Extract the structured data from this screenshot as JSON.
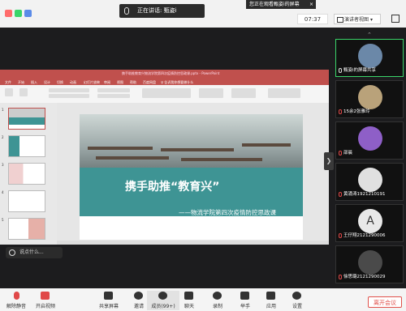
{
  "topbar": {
    "speaking_label": "正在讲话: 甄姿i",
    "viewing_label": "您正在观看甄姿i的屏幕",
    "close_icon": "×",
    "time": "07:37",
    "view_button": "演讲者视图",
    "view_caret": "▾"
  },
  "presentation": {
    "window_title": "携手助推教育兴物流学院第四次疫情防控思政课.pptx - PowerPoint",
    "tabs": [
      "文件",
      "开始",
      "插入",
      "设计",
      "切换",
      "动画",
      "幻灯片放映",
      "审阅",
      "视图",
      "帮助",
      "百度网盘",
      "♀ 告诉我你想要做什么"
    ],
    "slide_title": "携手助推“教育兴”",
    "slide_subtitle": "——物流学院第四次疫情防控思政课",
    "thumb_numbers": [
      "1",
      "2",
      "3",
      "4",
      "5"
    ]
  },
  "chat_bubble": "说点什么...",
  "collapse_arrow": "❯",
  "panel_up_arrow": "⌃",
  "participants": [
    {
      "name": "甄姿i的屏幕共享",
      "mic_muted": false,
      "avatar_color": "#6b88a8",
      "active": true
    },
    {
      "name": "15余2张雅玲",
      "mic_muted": true,
      "avatar_color": "#b9a27a",
      "active": false
    },
    {
      "name": "邵晨",
      "mic_muted": true,
      "avatar_color": "#8e5fc7",
      "active": false
    },
    {
      "name": "黄涌涛1921210191",
      "mic_muted": true,
      "avatar_color": "#e0e0e0",
      "active": false
    },
    {
      "name": "王仔翔2121290006",
      "mic_muted": true,
      "avatar_color": "#e8e8e8",
      "active": false,
      "letter": "A"
    },
    {
      "name": "徐思璐2121290029",
      "mic_muted": true,
      "avatar_color": "#4a4a4a",
      "active": false
    }
  ],
  "toolbar": {
    "items": [
      {
        "label": "解除静音",
        "icon": "mic-icon"
      },
      {
        "label": "开启视频",
        "icon": "video-icon"
      },
      {
        "label": "共享屏幕",
        "icon": "share-screen-icon"
      },
      {
        "label": "邀请",
        "icon": "invite-icon"
      },
      {
        "label": "成员(99+)",
        "icon": "members-icon"
      },
      {
        "label": "聊天",
        "icon": "chat-icon"
      },
      {
        "label": "录制",
        "icon": "record-icon"
      },
      {
        "label": "举手",
        "icon": "raise-hand-icon"
      },
      {
        "label": "应用",
        "icon": "apps-icon"
      },
      {
        "label": "设置",
        "icon": "settings-icon"
      }
    ],
    "end_button": "离开会议"
  },
  "colors": {
    "accent_green": "#3ad56a",
    "ppt_red": "#c0504d",
    "slide_teal": "#3e9494",
    "end_red": "#e0504a"
  }
}
